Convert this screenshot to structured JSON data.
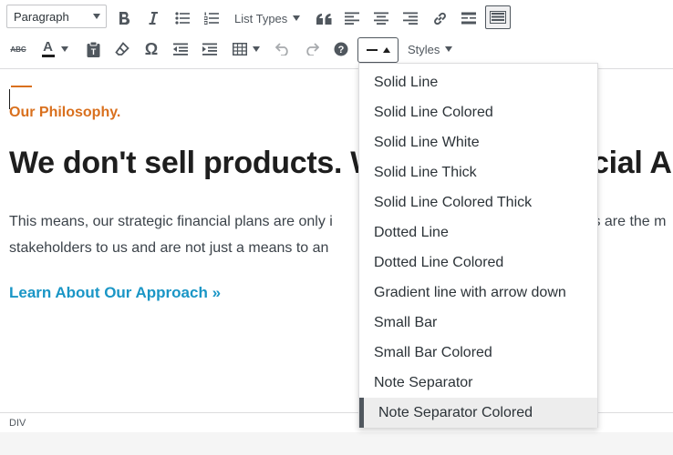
{
  "toolbar": {
    "format_select": "Paragraph",
    "list_types": "List Types",
    "abc_label": "ABC",
    "text_color_label": "A",
    "styles": "Styles"
  },
  "content": {
    "eyebrow": "Our Philosophy.",
    "headline": "We don't sell products. W",
    "headline_tail": "cial A",
    "body_line1": "This means, our strategic financial plans are only i",
    "body_line1_tail": "ts are the m",
    "body_line2": "stakeholders to us and are not just a means to an",
    "cta": "Learn About Our Approach »"
  },
  "status": {
    "path": "DIV"
  },
  "hr_menu": {
    "items": [
      "Solid Line",
      "Solid Line Colored",
      "Solid Line White",
      "Solid Line Thick",
      "Solid Line Colored Thick",
      "Dotted Line",
      "Dotted Line Colored",
      "Gradient line with arrow down",
      "Small Bar",
      "Small Bar Colored",
      "Note Separator",
      "Note Separator Colored"
    ],
    "active_index": 11
  },
  "colors": {
    "accent_orange": "#d9701e",
    "link_blue": "#1a96c6",
    "text_dark": "#1e1e1e"
  }
}
